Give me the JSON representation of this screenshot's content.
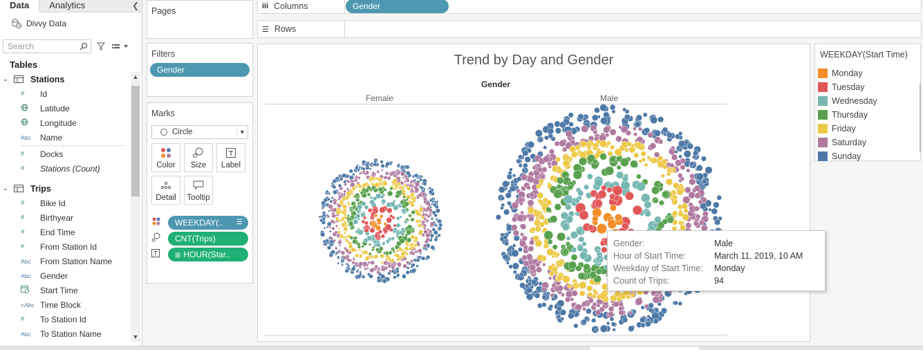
{
  "datapane": {
    "tabs": [
      {
        "label": "Data"
      },
      {
        "label": "Analytics"
      }
    ],
    "collapse_glyph": "❮",
    "datasource": "Divvy Data",
    "search_placeholder": "Search",
    "tables_heading": "Tables",
    "groups": [
      {
        "name": "Stations",
        "fields": [
          {
            "type": "#",
            "name": "Id"
          },
          {
            "type": "globe",
            "name": "Latitude"
          },
          {
            "type": "globe",
            "name": "Longitude"
          },
          {
            "type": "Abc",
            "name": "Name"
          },
          {
            "type": "sep"
          },
          {
            "type": "#",
            "name": "Docks"
          },
          {
            "type": "#",
            "name": "Stations (Count)",
            "italic": true
          }
        ]
      },
      {
        "name": "Trips",
        "fields": [
          {
            "type": "#",
            "name": "Bike Id"
          },
          {
            "type": "#",
            "name": "Birthyear"
          },
          {
            "type": "#",
            "name": "End Time"
          },
          {
            "type": "#",
            "name": "From Station Id"
          },
          {
            "type": "Abc",
            "name": "From Station Name"
          },
          {
            "type": "Abc",
            "name": "Gender"
          },
          {
            "type": "date",
            "name": "Start Time"
          },
          {
            "type": "=Abc",
            "name": "Time Block"
          },
          {
            "type": "#",
            "name": "To Station Id"
          },
          {
            "type": "Abc",
            "name": "To Station Name"
          }
        ]
      }
    ]
  },
  "shelves": {
    "pages": "Pages",
    "filters": "Filters",
    "filter_pill": "Gender",
    "marks": "Marks",
    "mark_type": "Circle",
    "encodings": [
      "Color",
      "Size",
      "Label",
      "Detail",
      "Tooltip"
    ],
    "mark_pills": [
      "WEEKDAY(..",
      "CNT(Trips)",
      "HOUR(Star.."
    ],
    "columns_label": "Columns",
    "columns_pill": "Gender",
    "rows_label": "Rows"
  },
  "viz": {
    "title": "Trend by Day and Gender",
    "column_header": "Gender",
    "panes": [
      "Female",
      "Male"
    ]
  },
  "legend": {
    "title": "WEEKDAY(Start Time)",
    "items": [
      {
        "label": "Monday",
        "color": "#f28e2b"
      },
      {
        "label": "Tuesday",
        "color": "#e15759"
      },
      {
        "label": "Wednesday",
        "color": "#76b7b2"
      },
      {
        "label": "Thursday",
        "color": "#59a14f"
      },
      {
        "label": "Friday",
        "color": "#edc948"
      },
      {
        "label": "Saturday",
        "color": "#b07aa1"
      },
      {
        "label": "Sunday",
        "color": "#4e79a7"
      }
    ]
  },
  "tooltip": {
    "rows": [
      {
        "key": "Gender:",
        "value": "Male"
      },
      {
        "key": "Hour of Start Time:",
        "value": "March 11, 2019, 10 AM"
      },
      {
        "key": "Weekday of Start Time:",
        "value": "Monday"
      },
      {
        "key": "Count of Trips:",
        "value": "94"
      }
    ]
  }
}
